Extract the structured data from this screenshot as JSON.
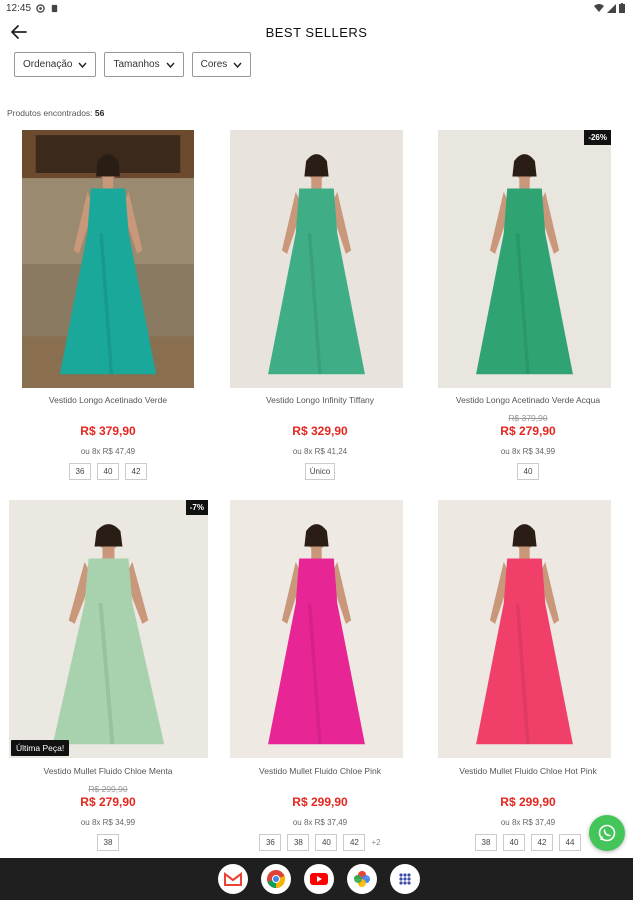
{
  "status_bar": {
    "time": "12:45"
  },
  "header": {
    "title": "BEST SELLERS"
  },
  "filters": [
    {
      "label": "Ordenação"
    },
    {
      "label": "Tamanhos"
    },
    {
      "label": "Cores"
    }
  ],
  "results": {
    "label": "Produtos encontrados:",
    "count": "56"
  },
  "products": [
    {
      "name": "Vestido Longo Acetinado Verde",
      "old_price": "",
      "price": "R$ 379,90",
      "installments": "ou 8x R$ 47,49",
      "sizes": [
        "36",
        "40",
        "42"
      ],
      "badge": "",
      "tag": "",
      "colors": {
        "bg": "#8a7a62",
        "dress": "#1aa89a"
      }
    },
    {
      "name": "Vestido Longo Infinity Tiffany",
      "old_price": "",
      "price": "R$ 329,90",
      "installments": "ou 8x R$ 41,24",
      "sizes": [
        "Único"
      ],
      "badge": "",
      "tag": "",
      "colors": {
        "bg": "#e8e3dc",
        "dress": "#3fae86"
      }
    },
    {
      "name": "Vestido Longo Acetinado Verde Acqua",
      "old_price": "R$ 379,90",
      "price": "R$ 279,90",
      "installments": "ou 8x R$ 34,99",
      "sizes": [
        "40"
      ],
      "badge": "-26%",
      "tag": "",
      "colors": {
        "bg": "#e9e5df",
        "dress": "#2fa472"
      }
    },
    {
      "name": "Vestido Mullet Fluido Chloe Menta",
      "old_price": "R$ 299,90",
      "price": "R$ 279,90",
      "installments": "ou 8x R$ 34,99",
      "sizes": [
        "38"
      ],
      "badge": "-7%",
      "tag": "Última Peça!",
      "colors": {
        "bg": "#ebe7e1",
        "dress": "#a8d1ad"
      }
    },
    {
      "name": "Vestido Mullet Fluido Chloe Pink",
      "old_price": "",
      "price": "R$ 299,90",
      "installments": "ou 8x R$ 37,49",
      "sizes": [
        "36",
        "38",
        "40",
        "42"
      ],
      "more": "+2",
      "badge": "",
      "tag": "",
      "colors": {
        "bg": "#eee9e3",
        "dress": "#e82594"
      }
    },
    {
      "name": "Vestido Mullet Fluido Chloe Hot Pink",
      "old_price": "",
      "price": "R$ 299,90",
      "installments": "ou 8x R$ 37,49",
      "sizes": [
        "38",
        "40",
        "42",
        "44"
      ],
      "badge": "",
      "tag": "",
      "colors": {
        "bg": "#ede8e2",
        "dress": "#f0406a"
      }
    }
  ],
  "dock": {
    "apps": [
      "gmail-icon",
      "chrome-icon",
      "youtube-icon",
      "photos-icon",
      "app-drawer-icon"
    ]
  }
}
